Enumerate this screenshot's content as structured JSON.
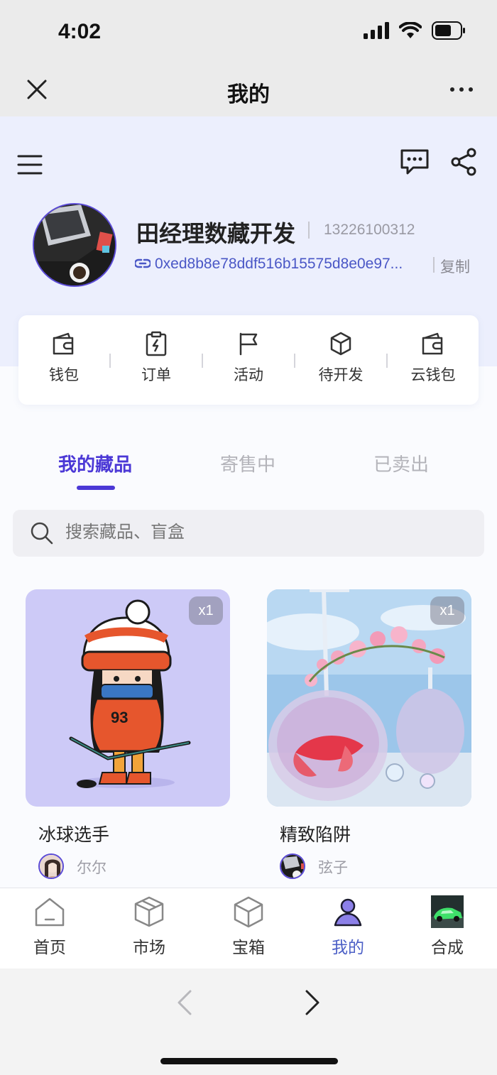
{
  "status_bar": {
    "time": "4:02"
  },
  "nav": {
    "title": "我的"
  },
  "profile": {
    "name": "田经理数藏开发",
    "phone": "13226100312",
    "address": "0xed8b8e78ddf516b15575d8e0e97...",
    "copy_label": "复制"
  },
  "quick_actions": [
    {
      "label": "钱包",
      "icon": "wallet-icon"
    },
    {
      "label": "订单",
      "icon": "order-icon"
    },
    {
      "label": "活动",
      "icon": "flag-icon"
    },
    {
      "label": "待开发",
      "icon": "cube-icon"
    },
    {
      "label": "云钱包",
      "icon": "cloud-wallet-icon"
    }
  ],
  "tabs": [
    {
      "label": "我的藏品",
      "active": true
    },
    {
      "label": "寄售中",
      "active": false
    },
    {
      "label": "已卖出",
      "active": false
    }
  ],
  "search": {
    "placeholder": "搜索藏品、盲盒"
  },
  "collections": [
    {
      "title": "冰球选手",
      "count": "x1",
      "author": "尔尔"
    },
    {
      "title": "精致陷阱",
      "count": "x1",
      "author": "弦子"
    }
  ],
  "tab_bar": [
    {
      "label": "首页",
      "icon": "home-icon",
      "active": false
    },
    {
      "label": "市场",
      "icon": "market-box-icon",
      "active": false
    },
    {
      "label": "宝箱",
      "icon": "treasure-box-icon",
      "active": false
    },
    {
      "label": "我的",
      "icon": "user-icon",
      "active": true
    },
    {
      "label": "合成",
      "icon": "synthesis-thumbnail",
      "active": false
    }
  ],
  "colors": {
    "accent": "#4b38d6",
    "hero_bg": "#eceffd",
    "active_tab_bar": "#4b5fc6"
  }
}
